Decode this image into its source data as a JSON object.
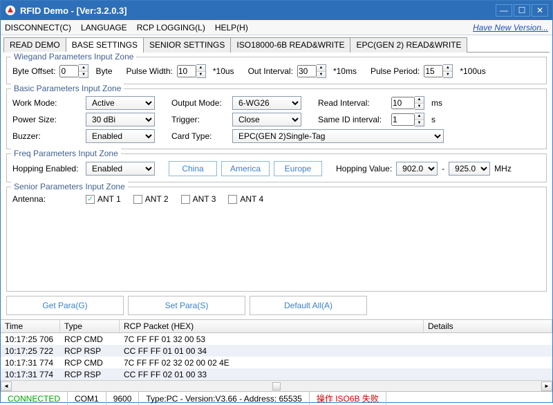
{
  "window": {
    "title": "RFID Demo - [Ver:3.2.0.3]"
  },
  "menu": {
    "disconnect": "DISCONNECT(C)",
    "language": "LANGUAGE",
    "rcp_logging": "RCP LOGGING(L)",
    "help": "HELP(H)",
    "new_version": "Have New Version..."
  },
  "tabs": [
    "READ DEMO",
    "BASE SETTINGS",
    "SENIOR SETTINGS",
    "ISO18000-6B READ&WRITE",
    "EPC(GEN 2) READ&WRITE"
  ],
  "wiegand": {
    "legend": "Wiegand Parameters Input Zone",
    "byte_offset_lbl": "Byte Offset:",
    "byte_offset": "0",
    "byte_unit": "Byte",
    "pulse_width_lbl": "Pulse Width:",
    "pulse_width": "10",
    "pulse_width_unit": "*10us",
    "out_interval_lbl": "Out Interval:",
    "out_interval": "30",
    "out_interval_unit": "*10ms",
    "pulse_period_lbl": "Pulse Period:",
    "pulse_period": "15",
    "pulse_period_unit": "*100us"
  },
  "basic": {
    "legend": "Basic Parameters Input Zone",
    "work_mode_lbl": "Work Mode:",
    "work_mode": "Active",
    "output_mode_lbl": "Output Mode:",
    "output_mode": "6-WG26",
    "read_interval_lbl": "Read Interval:",
    "read_interval": "10",
    "read_interval_unit": "ms",
    "power_size_lbl": "Power Size:",
    "power_size": "30 dBi",
    "trigger_lbl": "Trigger:",
    "trigger": "Close",
    "same_id_lbl": "Same ID interval:",
    "same_id": "1",
    "same_id_unit": "s",
    "buzzer_lbl": "Buzzer:",
    "buzzer": "Enabled",
    "card_type_lbl": "Card Type:",
    "card_type": "EPC(GEN 2)Single-Tag"
  },
  "freq": {
    "legend": "Freq Parameters Input Zone",
    "hopping_enabled_lbl": "Hopping Enabled:",
    "hopping_enabled": "Enabled",
    "regions": [
      "China",
      "America",
      "Europe"
    ],
    "hopping_value_lbl": "Hopping Value:",
    "hop_low": "902.0",
    "hop_high": "925.0",
    "hop_unit": "MHz",
    "dash": "-"
  },
  "senior": {
    "legend": "Senior Parameters Input Zone",
    "antenna_lbl": "Antenna:",
    "ants": [
      "ANT 1",
      "ANT 2",
      "ANT 3",
      "ANT 4"
    ]
  },
  "actions": {
    "get": "Get Para(G)",
    "set": "Set Para(S)",
    "default": "Default All(A)"
  },
  "log": {
    "cols": {
      "time": "Time",
      "type": "Type",
      "packet": "RCP Packet (HEX)",
      "details": "Details"
    },
    "rows": [
      {
        "time": "10:17:25 706",
        "type": "RCP CMD",
        "packet": "7C FF FF 01 32 00 53"
      },
      {
        "time": "10:17:25 722",
        "type": "RCP RSP",
        "packet": "CC FF FF 01 01 00 34"
      },
      {
        "time": "10:17:31 774",
        "type": "RCP CMD",
        "packet": "7C FF FF 02 32 02 00 02 4E"
      },
      {
        "time": "10:17:31 774",
        "type": "RCP RSP",
        "packet": "CC FF FF 02 01 00 33"
      }
    ]
  },
  "status": {
    "connected": "CONNECTED",
    "port": "COM1",
    "baud": "9600",
    "info": "Type:PC - Version:V3.66 - Address: 65535",
    "err": "操作 ISO6B 失败"
  }
}
